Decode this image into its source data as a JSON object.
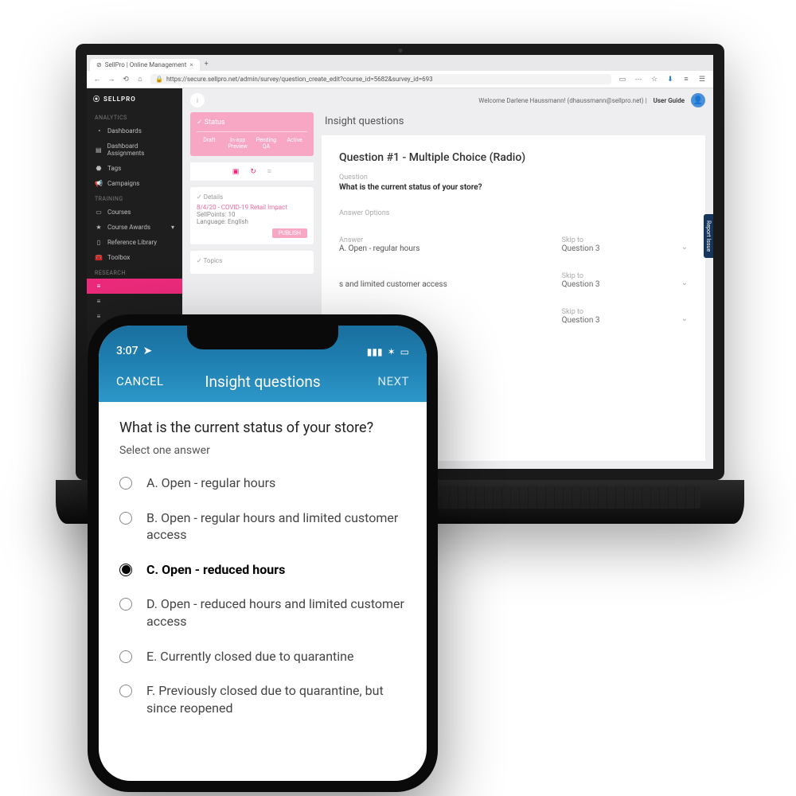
{
  "browser": {
    "tab_title": "SellPro | Online Management",
    "url": "https://secure.sellpro.net/admin/survey/question_create_edit?course_id=5682&survey_id=693"
  },
  "sidebar": {
    "brand": "SELLPRO",
    "sections": [
      {
        "label": "ANALYTICS",
        "items": [
          {
            "icon": "◔",
            "label": "Dashboards"
          },
          {
            "icon": "▤",
            "label": "Dashboard Assignments"
          },
          {
            "icon": "⬣",
            "label": "Tags"
          },
          {
            "icon": "📢",
            "label": "Campaigns"
          }
        ]
      },
      {
        "label": "TRAINING",
        "items": [
          {
            "icon": "▭",
            "label": "Courses"
          },
          {
            "icon": "★",
            "label": "Course Awards"
          },
          {
            "icon": "▯",
            "label": "Reference Library"
          },
          {
            "icon": "🧰",
            "label": "Toolbox"
          }
        ]
      },
      {
        "label": "RESEARCH",
        "items": [
          {
            "icon": "≡",
            "label": "",
            "active": true
          },
          {
            "icon": "≡",
            "label": ""
          },
          {
            "icon": "≡",
            "label": ""
          }
        ]
      }
    ]
  },
  "topbar": {
    "welcome": "Welcome Darlene Haussmann! (dhaussmann@sellpro.net) |",
    "user_guide": "User Guide"
  },
  "leftcol": {
    "status": {
      "title": "Status",
      "steps": [
        "Draft",
        "In-app Preview",
        "Pending QA",
        "Active"
      ]
    },
    "details": {
      "title": "Details",
      "line1": "8/4/20 - COVID-19 Retail Impact",
      "line2": "SellPoints: 10",
      "line3": "Language: English",
      "publish": "PUBLISH"
    },
    "topics": {
      "title": "Topics"
    }
  },
  "page": {
    "title": "Insight questions",
    "question_title": "Question #1 - Multiple Choice (Radio)",
    "question_label": "Question",
    "question_text": "What is the current status of your store?",
    "answer_options_label": "Answer Options",
    "answer_label": "Answer",
    "skip_label": "Skip to",
    "answers": [
      {
        "text": "A.  Open - regular hours",
        "skip": "Question 3"
      },
      {
        "text": "s and limited customer access",
        "skip": "Question 3"
      },
      {
        "text": "",
        "skip": "Question 3"
      }
    ]
  },
  "report_issue": "Report Issue",
  "phone": {
    "time": "3:07",
    "cancel": "CANCEL",
    "title": "Insight questions",
    "next": "NEXT",
    "question": "What is the current status of your store?",
    "hint": "Select one answer",
    "options": [
      {
        "text": "A.  Open - regular hours",
        "selected": false
      },
      {
        "text": "B.  Open - regular hours and limited customer access",
        "selected": false
      },
      {
        "text": "C.  Open - reduced hours",
        "selected": true
      },
      {
        "text": "D.  Open - reduced hours and limited customer access",
        "selected": false
      },
      {
        "text": "E.  Currently closed due to quarantine",
        "selected": false
      },
      {
        "text": "F.  Previously closed due to quarantine, but since reopened",
        "selected": false
      }
    ]
  }
}
